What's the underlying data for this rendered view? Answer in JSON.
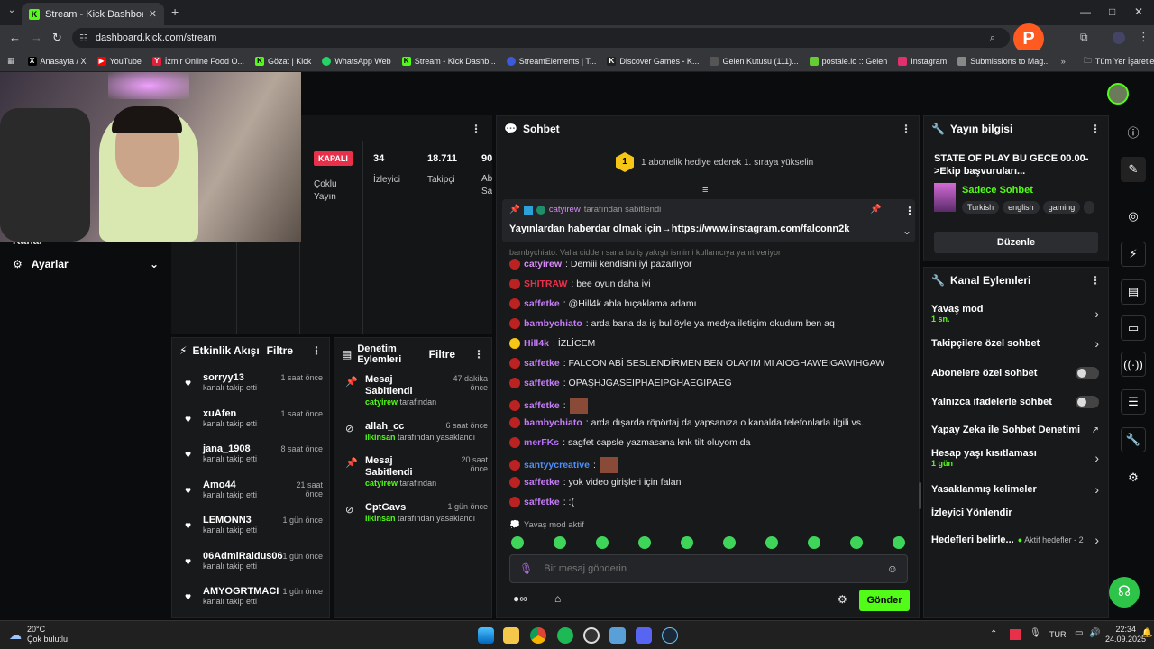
{
  "browser": {
    "tab_title": "Stream - Kick Dashboard",
    "url": "dashboard.kick.com/stream",
    "bookmarks": [
      "Anasayfa / X",
      "YouTube",
      "İzmir Online Food O...",
      "Gözat | Kick",
      "WhatsApp Web",
      "Stream - Kick Dashb...",
      "StreamElements | T...",
      "Discover Games - K...",
      "Gelen Kutusu (111)...",
      "postale.io :: Gelen",
      "Instagram",
      "Submissions to Mag..."
    ],
    "all_bookmarks": "Tüm Yer İşaretleri"
  },
  "left": {
    "settings_label": "Ayarlar",
    "partial_label": "Kanal"
  },
  "stats": {
    "status_badge": "KAPALI",
    "multistream": "Çoklu Yayın",
    "viewers_value": "34",
    "viewers_label": "İzleyici",
    "followers_value": "18.711",
    "followers_label": "Takipçi",
    "partial_value": "90",
    "partial_label": "Ab Sa"
  },
  "activity": {
    "title": "Etkinlik Akışı",
    "filter": "Filtre",
    "items": [
      {
        "name": "sorryy13",
        "sub": "kanalı takip etti",
        "time": "1 saat önce"
      },
      {
        "name": "xuAfen",
        "sub": "kanalı takip etti",
        "time": "1 saat önce"
      },
      {
        "name": "jana_1908",
        "sub": "kanalı takip etti",
        "time": "8 saat önce"
      },
      {
        "name": "Amo44",
        "sub": "kanalı takip etti",
        "time": "21 saat önce"
      },
      {
        "name": "LEMONN3",
        "sub": "kanalı takip etti",
        "time": "1 gün önce"
      },
      {
        "name": "06AdmiRaldus06",
        "sub": "kanalı takip etti",
        "time": "1 gün önce"
      },
      {
        "name": "AMYOGRTMACI",
        "sub": "kanalı takip etti",
        "time": "1 gün önce"
      }
    ]
  },
  "moderation": {
    "title": "Denetim Eylemleri",
    "filter": "Filtre",
    "items": [
      {
        "action": "Mesaj Sabitlendi",
        "user": "catyirew",
        "suffix": "tarafından",
        "time": "47 dakika önce"
      },
      {
        "action": "allah_cc",
        "user": "ilkinsan",
        "suffix": "tarafından yasaklandı",
        "time": "6 saat önce"
      },
      {
        "action": "Mesaj Sabitlendi",
        "user": "catyirew",
        "suffix": "tarafından",
        "time": "20 saat önce"
      },
      {
        "action": "CptGavs",
        "user": "ilkinsan",
        "suffix": "tarafından yasaklandı",
        "time": "1 gün önce"
      }
    ]
  },
  "chat": {
    "title": "Sohbet",
    "gift_rank": "1",
    "gift_text": "1 abonelik hediye ederek 1. sıraya yükselin",
    "pinned_by_user": "catyirew",
    "pinned_by_suffix": "tarafından sabitlendi",
    "pinned_text": "Yayınlardan haberdar olmak için→",
    "pinned_link": "https://www.instagram.com/falconn2k",
    "reply_hint": "bambychiato: Valla cidden sana bu iş yakıştı ismimi kullanıcıya yanıt veriyor",
    "messages": [
      {
        "user": "catyirew",
        "text": ": Demiii kendisini iyi pazarlıyor",
        "color": "#d58cf5"
      },
      {
        "user": "SHITRAW",
        "text": ": bee oyun daha iyi",
        "color": "#e8304a"
      },
      {
        "user": "saffetke",
        "text": ": @Hill4k abla bıçaklama adamı",
        "color": "#c57cf7"
      },
      {
        "user": "bambychiato",
        "text": ": arda bana da iş bul öyle ya medya iletişim okudum ben aq",
        "color": "#c57cf7"
      },
      {
        "user": "Hill4k",
        "text": ": İZLİCEM",
        "color": "#c57cf7"
      },
      {
        "user": "saffetke",
        "text": ": FALCON ABİ SESLENDİRMEN BEN OLAYIM MI AIOGHAWEIGAWIHGAW",
        "color": "#c57cf7"
      },
      {
        "user": "saffetke",
        "text": ": OPAŞHJGASEIPHAEIPGHAEGIPAEG",
        "color": "#c57cf7"
      },
      {
        "user": "saffetke",
        "text": ":",
        "color": "#c57cf7"
      },
      {
        "user": "bambychiato",
        "text": ": arda dışarda röpörtaj da yapsanıza o kanalda telefonlarla ilgili vs.",
        "color": "#c57cf7"
      },
      {
        "user": "merFKs",
        "text": ": sagfet capsle yazmasana knk tilt oluyom da",
        "color": "#b770f7"
      },
      {
        "user": "santyycreative",
        "text": ":",
        "color": "#4f8ef7"
      },
      {
        "user": "saffetke",
        "text": ": yok video girişleri için falan",
        "color": "#c57cf7"
      },
      {
        "user": "saffetke",
        "text": ": :(",
        "color": "#c57cf7"
      }
    ],
    "slow_mode": "Yavaş mod aktif",
    "input_placeholder": "Bir mesaj gönderin",
    "send": "Gönder"
  },
  "stream_info": {
    "title": "Yayın bilgisi",
    "stream_title": "STATE OF PLAY BU GECE 00.00- >Ekip başvuruları...",
    "category": "Sadece Sohbet",
    "tags": [
      "Turkish",
      "english",
      "gaming"
    ],
    "edit": "Düzenle"
  },
  "channel_actions": {
    "title": "Kanal Eylemleri",
    "slow_mode": "Yavaş mod",
    "slow_mode_value": "1 sn.",
    "followers_only": "Takipçilere özel sohbet",
    "subscribers_only": "Abonelere özel sohbet",
    "emotes_only": "Yalnızca ifadelerle sohbet",
    "ai_moderation": "Yapay Zeka ile Sohbet Denetimi",
    "age_restriction": "Hesap yaşı kısıtlaması",
    "age_value": "1 gün",
    "banned_words": "Yasaklanmış kelimeler",
    "redirect": "İzleyici Yönlendir",
    "goals": "Hedefleri belirle...",
    "goals_active": "Aktif hedefler - 2"
  },
  "taskbar": {
    "temp": "20°C",
    "weather": "Çok bulutlu",
    "lang": "TUR",
    "time": "22:34",
    "date": "24.09.2025"
  }
}
